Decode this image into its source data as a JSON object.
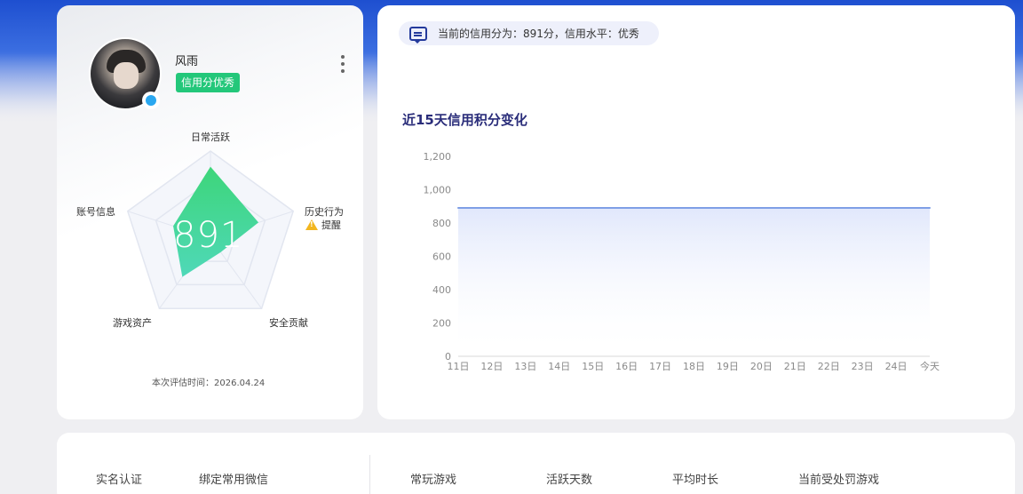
{
  "profile": {
    "username": "风雨",
    "credit_tag": "信用分优秀",
    "score": "891",
    "eval_time": "本次评估时间：2026.04.24",
    "radar": {
      "axes": [
        "日常活跃",
        "历史行为",
        "安全贡献",
        "游戏资产",
        "账号信息"
      ],
      "values": [
        0.82,
        0.58,
        0.2,
        0.55,
        0.45
      ],
      "warning_text": "提醒",
      "fill_color_top": "#3dd67a",
      "fill_color_bottom": "#4fd8b8"
    }
  },
  "info": {
    "credit_text": "当前的信用分为：891分，信用水平：优秀"
  },
  "chart_title": "近15天信用积分变化",
  "chart_data": {
    "type": "area",
    "x": [
      "11日",
      "12日",
      "13日",
      "14日",
      "15日",
      "16日",
      "17日",
      "18日",
      "19日",
      "20日",
      "21日",
      "22日",
      "23日",
      "24日",
      "今天"
    ],
    "series": [
      {
        "values": [
          891,
          891,
          891,
          891,
          891,
          891,
          891,
          891,
          891,
          891,
          891,
          891,
          891,
          891,
          891
        ]
      }
    ],
    "yticks": [
      "0",
      "200",
      "400",
      "600",
      "800",
      "1,000",
      "1,200"
    ],
    "ylim": [
      0,
      1200
    ],
    "grid": false,
    "line_color": "#7f9fe6",
    "fill_color": "#dfe6fb"
  },
  "bottom": {
    "labels": [
      "实名认证",
      "绑定常用微信",
      "常玩游戏",
      "活跃天数",
      "平均时长",
      "当前受处罚游戏"
    ]
  }
}
